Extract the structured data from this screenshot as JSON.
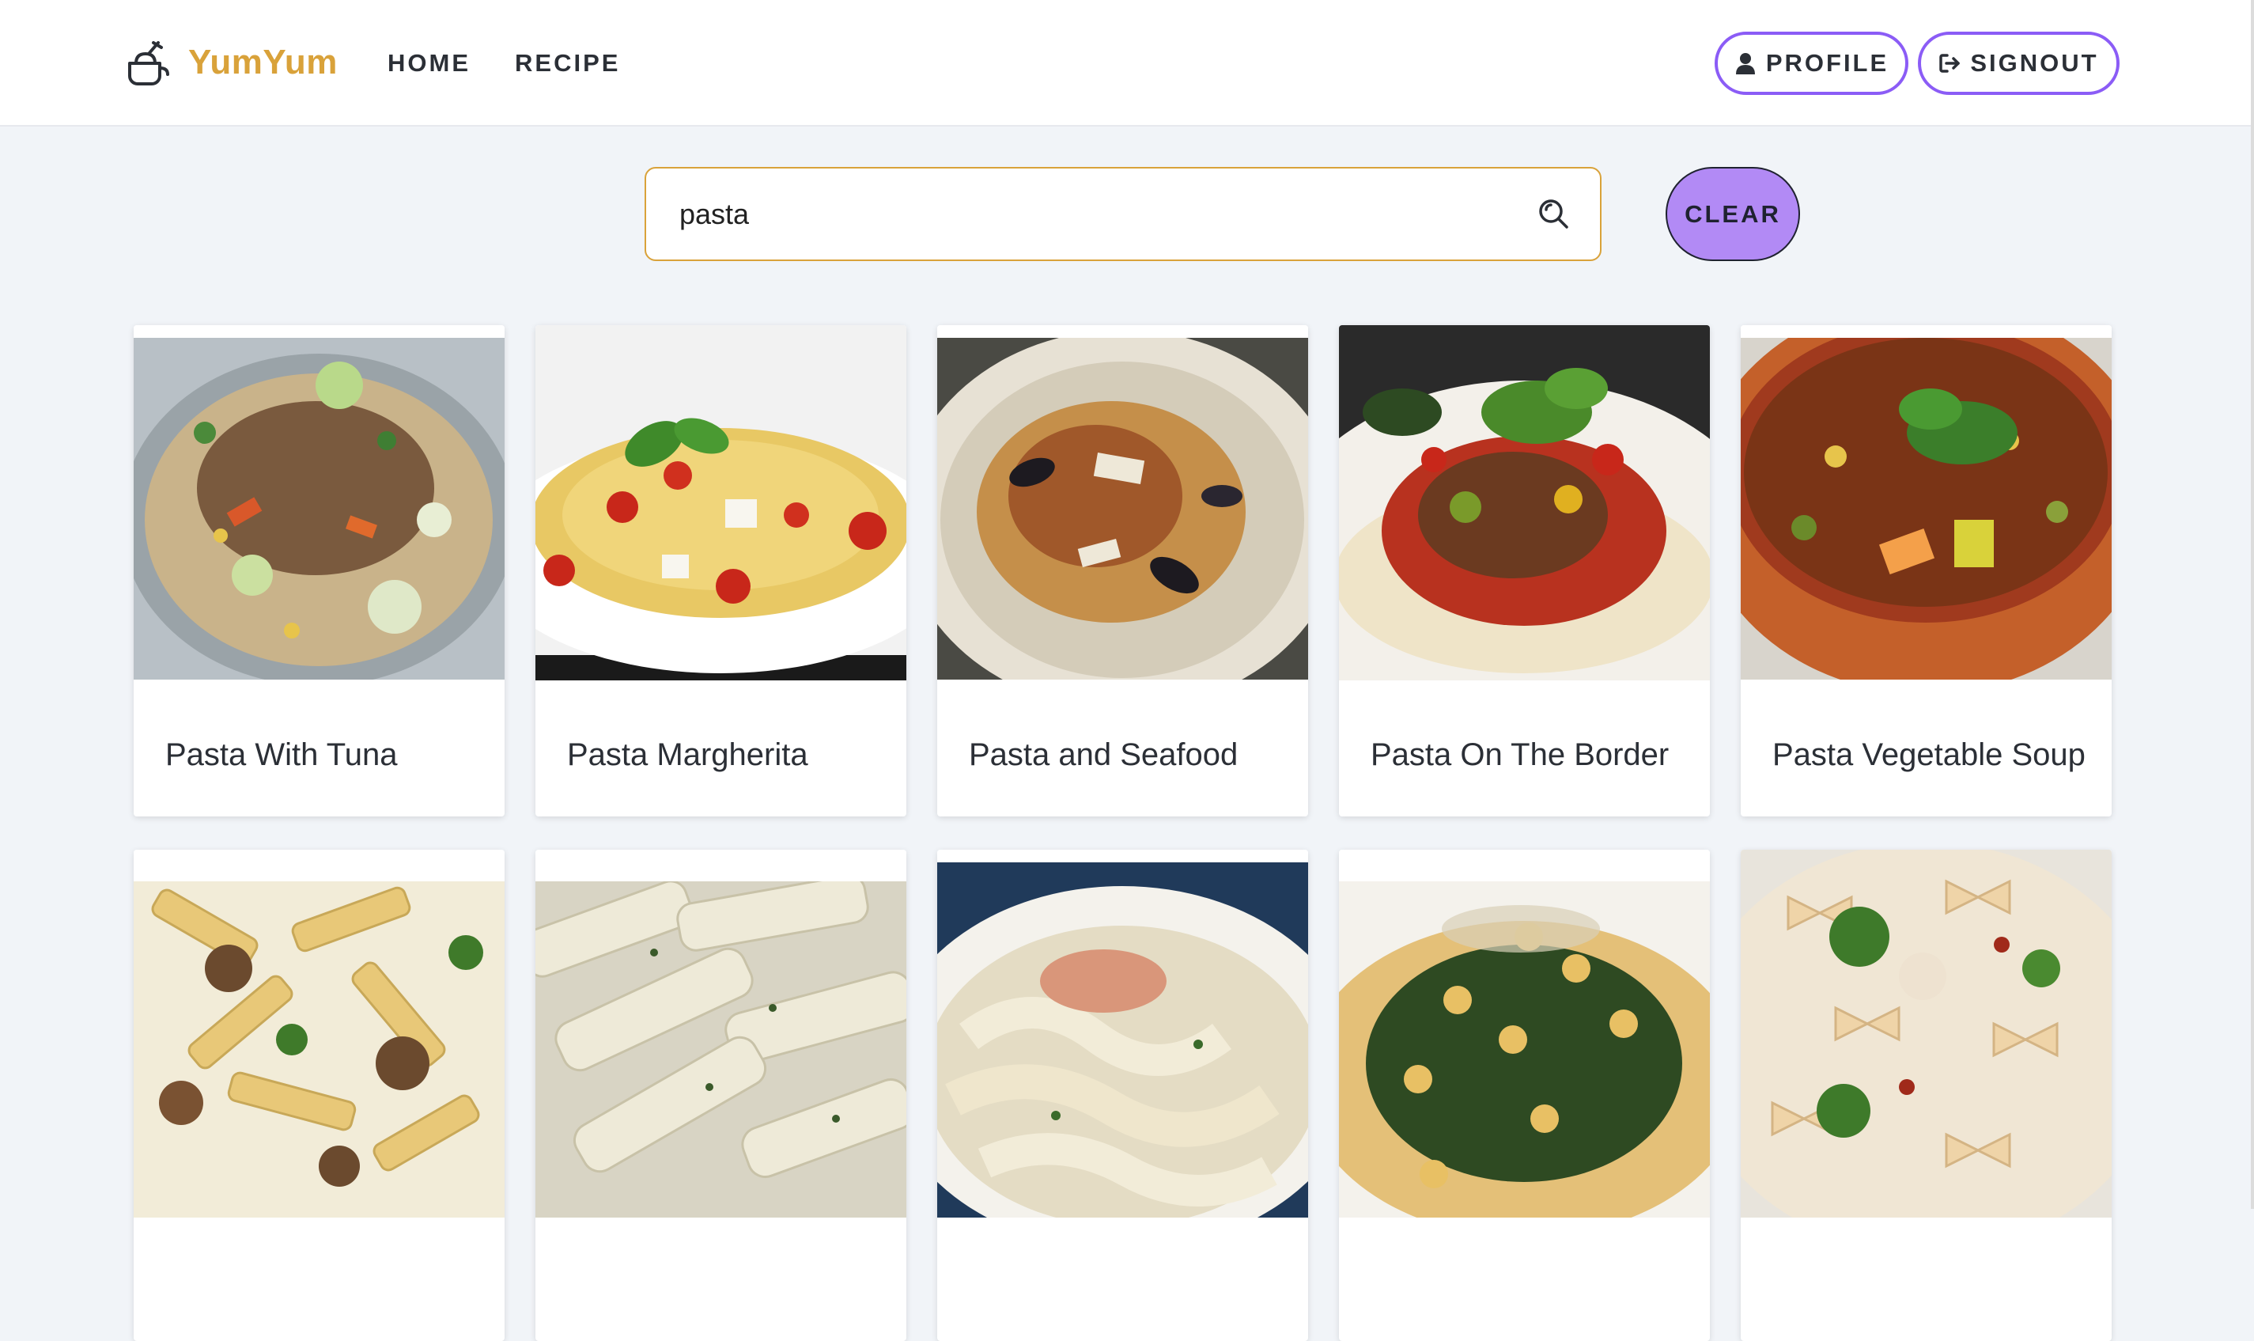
{
  "app": {
    "brand_name": "YumYum",
    "brand_icon": "food-bowl-icon",
    "accent_color": "#d9a23a",
    "button_color": "#8b5cf6"
  },
  "nav": {
    "home_label": "HOME",
    "recipe_label": "RECIPE",
    "profile_label": "PROFILE",
    "signout_label": "SIGNOUT"
  },
  "search": {
    "value": "pasta",
    "clear_label": "CLEAR"
  },
  "recipes": [
    {
      "title": "Pasta With Tuna",
      "image": "pasta-tuna-photo"
    },
    {
      "title": "Pasta Margherita",
      "image": "pasta-margherita-photo"
    },
    {
      "title": "Pasta and Seafood",
      "image": "pasta-seafood-photo"
    },
    {
      "title": "Pasta On The Border",
      "image": "pasta-border-photo"
    },
    {
      "title": "Pasta Vegetable Soup",
      "image": "pasta-soup-photo"
    },
    {
      "title": "",
      "image": "penne-sausage-photo"
    },
    {
      "title": "",
      "image": "penne-cream-photo"
    },
    {
      "title": "",
      "image": "pappardelle-photo"
    },
    {
      "title": "",
      "image": "spaghetti-chickpea-photo"
    },
    {
      "title": "",
      "image": "farfalle-broccoli-photo"
    }
  ]
}
